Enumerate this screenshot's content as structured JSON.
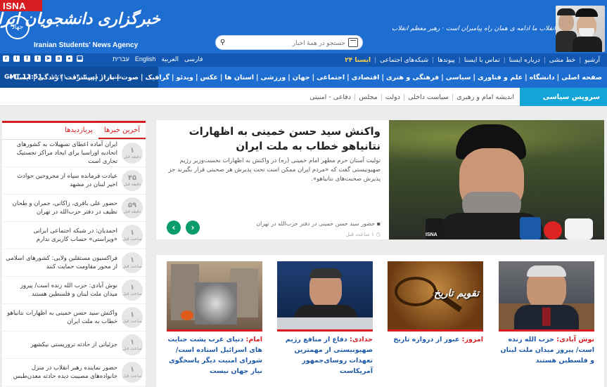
{
  "header": {
    "logo_badge": "ISNA",
    "logo_emblem": "جهاد",
    "logo_fa": "خبرگزاری دانشجویان ایران، ایسنا",
    "logo_en": "Iranian Students' News Agency",
    "slogan": "انقلاب ما ادامه ی همان راه پیامبران است · رهبر معظم انقلاب",
    "search": {
      "placeholder": "جستجو در همهٔ اخبار"
    }
  },
  "linkbar": {
    "items": [
      "آرشیو",
      "خط مشی",
      "درباره ایسنا",
      "تماس با ایسنا",
      "پیوندها",
      "شبکه‌های اجتماعی"
    ],
    "isna24": "ایسنا ۲۴",
    "languages": [
      "فارسی",
      "العربية",
      "English",
      "עברית"
    ]
  },
  "navbar": {
    "date": "شنبه ۱۰ مهر ۱۴۰۳ - ۱۵:۲۱",
    "gmt": "GMT 11:51",
    "sections": [
      "صفحه اصلی",
      "دانشگاه",
      "علم و فناوری",
      "سیاسی",
      "فرهنگی و هنری",
      "اقتصادی",
      "اجتماعی",
      "جهان",
      "ورزشی",
      "استان ها",
      "عکس",
      "ویدئو",
      "گرافیک",
      "صوت",
      "بازار",
      "پیشرفت",
      "زندگی",
      "ایسنا+"
    ]
  },
  "subnav": {
    "service": "سرویس سیاسی",
    "items": [
      "اندیشه امام و رهبری",
      "سیاست داخلی",
      "دولت",
      "مجلس",
      "دفاعی - امنیتی"
    ]
  },
  "sidebar": {
    "tabs": [
      "آخرین خبرها",
      "پربازدیدها"
    ],
    "items": [
      {
        "num": "۱",
        "unit": "دقیقه قبل",
        "text": "ایران آماده اعطای تسهیلات به کشورهای اتحادیه اوراسیا برای ایجاد مراکز تجستیک تجاری است"
      },
      {
        "num": "۴۵",
        "unit": "دقیقه قبل",
        "text": "عیادت فرمانده سپاه از مجروحین حوادث اخیر لبنان در مشهد"
      },
      {
        "num": "۵۹",
        "unit": "دقیقه قبل",
        "text": "حضور علی باقری، زاکانی، جمران و طحان نظیف در دفتر حزب‌الله در تهران"
      },
      {
        "num": "۱",
        "unit": "ساعت قبل",
        "text": "احمدیان: در شبکه اجتماعی ایرانی «ویراستی» حساب کاربری ندارم"
      },
      {
        "num": "۱",
        "unit": "ساعت قبل",
        "text": "فراکسیون مستقلین ولایی: کشورهای اسلامی از محور مقاومت حمایت کنند"
      },
      {
        "num": "۱",
        "unit": "ساعت قبل",
        "text": "نوش آبادی: حزب الله زنده است/ پیروز میدان ملت لبنان و فلسطین هستند"
      },
      {
        "num": "۱",
        "unit": "ساعت قبل",
        "text": "واکنش سید حسن خمینی به اظهارات نتانیاهو خطاب به ملت ایران"
      },
      {
        "num": "۱",
        "unit": "ساعت قبل",
        "text": "جزئیاتی از حادثه تروریستی نیکشهر"
      },
      {
        "num": "۱",
        "unit": "ساعت قبل",
        "text": "حضور نماینده رهبر انقلاب در منزل خانواده‌های مصیبت دیده حادثه معدن‌طبس"
      }
    ]
  },
  "feature": {
    "title": "واکنش سید حسن خمینی به اظهارات نتانیاهو خطاب به ملت ایران",
    "lead": "تولیت آستان حرم مطهر امام خمینی (ره) در واکنش به اظهارات نخست‌وزیر رژیم صهیونیستی گفت که «مردم ایران ممکن است تحت پذیرش هر صحبتی قرار بگیرند جز پذیرش صحبت‌های نتانیاهو».",
    "caption": "حضور سید حسن خمینی در دفتر حزب‌الله در تهران",
    "time": "۱ ساعت قبل",
    "mic_label": "ISNA"
  },
  "cards": [
    {
      "kw": "نوش آبادی:",
      "text": " حزب الله زنده است/ پیروز میدان ملت لبنان و فلسطین هستند"
    },
    {
      "kw": "امروز:",
      "text": " عبور از دروازه تاریخ"
    },
    {
      "kw": "حدادی:",
      "text": " دفاع از منافع رژیم صهیونیستی از مهمترین تعهدات روسای‌جمهور آمریکاست"
    },
    {
      "kw": "امام:",
      "text": " دنیای غرب پشت جنایت های اسرائیل استاده است/ شورای امنیت دیگر پاسخگوی نیاز جهان نیست"
    }
  ],
  "card2_img_text": "تقویم تاریخ",
  "colors": {
    "brand_blue": "#1e6ed1",
    "dark_blue": "#1258b2",
    "accent_red": "#d71d22",
    "service_cyan": "#13a5d7",
    "arrow_green": "#0a9d6b"
  }
}
